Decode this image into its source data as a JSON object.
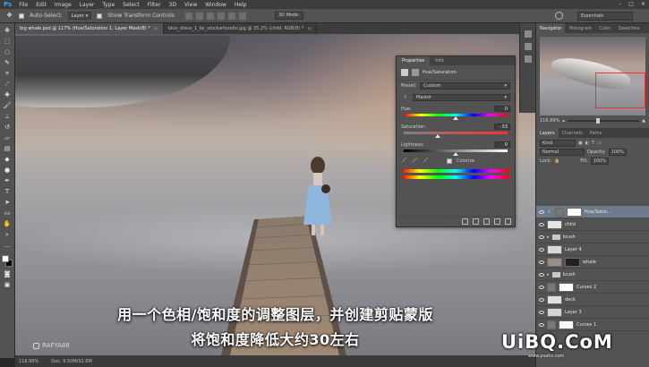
{
  "app": {
    "logo": "Ps"
  },
  "menu": [
    "File",
    "Edit",
    "Image",
    "Layer",
    "Type",
    "Select",
    "Filter",
    "3D",
    "View",
    "Window",
    "Help"
  ],
  "options": {
    "auto_select": "Auto-Select:",
    "auto_select_target": "Layer",
    "show_transform": "Show Transform Controls",
    "mode_3d": "3D Mode:",
    "workspace": "Essentials"
  },
  "doc_tabs": [
    {
      "label": "big whale.psd @ 117% (Hue/Saturation 1, Layer Mask/8) *",
      "active": true
    },
    {
      "label": "blue_dress_1_by_stockwhoodie.jpg @ 35.2% (child, RGB/8) *",
      "active": false
    }
  ],
  "status": {
    "zoom": "116.99%",
    "doc": "Doc: 9.50M/91.6M"
  },
  "subtitle": {
    "line1": "用一个色相/饱和度的调整图层，并创建剪贴蒙版",
    "line2": "将饱和度降低大约30左右"
  },
  "watermark_left": "RAFYA88",
  "site_watermark": {
    "main": "UiBQ.CoM",
    "sub": "www.psahz.com"
  },
  "properties": {
    "tabs": [
      "Properties",
      "Info"
    ],
    "header": "Hue/Saturation",
    "preset_label": "Preset:",
    "preset_value": "Custom",
    "channel_value": "Master",
    "hue_label": "Hue:",
    "hue_value": "0",
    "hue_level": 0.5,
    "saturation_label": "Saturation:",
    "saturation_value": "-33",
    "saturation_level": 0.33,
    "lightness_label": "Lightness:",
    "lightness_value": "0",
    "lightness_level": 0.5,
    "colorize_label": "Colorize"
  },
  "navigator": {
    "tabs": [
      "Navigator",
      "Histogram",
      "Color",
      "Swatches"
    ],
    "zoom": "116.99%"
  },
  "layers_panel": {
    "tabs": [
      "Layers",
      "Channels",
      "Paths"
    ],
    "kind": "Kind",
    "blend": "Normal",
    "opacity_label": "Opacity:",
    "opacity_value": "100%",
    "lock_label": "Lock:",
    "fill_label": "Fill:",
    "fill_value": "100%",
    "layers": [
      {
        "name": "Hue/Satur...",
        "type": "adjust",
        "selected": true
      },
      {
        "name": "child",
        "type": "image"
      },
      {
        "name": "brush",
        "type": "folder"
      },
      {
        "name": "Layer 4",
        "type": "image"
      },
      {
        "name": "whale",
        "type": "image"
      },
      {
        "name": "brush",
        "type": "folder"
      },
      {
        "name": "Curves 2",
        "type": "adjust"
      },
      {
        "name": "deck",
        "type": "image"
      },
      {
        "name": "Layer 3",
        "type": "image"
      },
      {
        "name": "Curves 1",
        "type": "adjust"
      }
    ]
  }
}
